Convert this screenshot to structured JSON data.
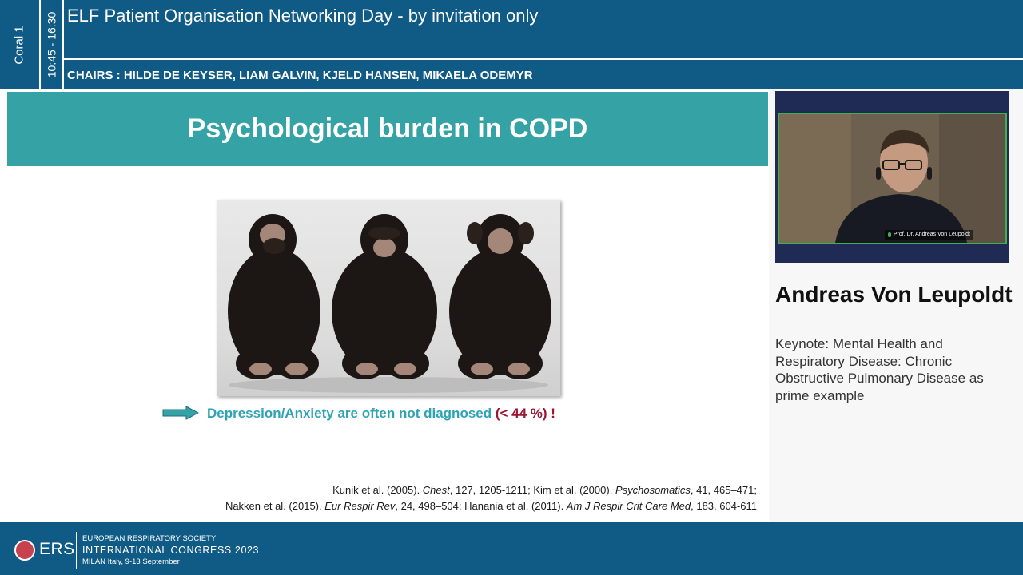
{
  "header": {
    "room": "Coral 1",
    "time": "10:45 - 16:30",
    "session_title": "ELF Patient Organisation Networking Day - by invitation only",
    "chairs": "CHAIRS : HILDE DE KEYSER, LIAM GALVIN, KJELD HANSEN, MIKAELA ODEMYR"
  },
  "slide": {
    "title": "Psychological burden in COPD",
    "message_main": "Depression/Anxiety are often not diagnosed ",
    "message_stat": "(< 44 %)",
    "message_end": " !",
    "ref1_a": "Kunik et al. (2005). ",
    "ref1_b": "Chest",
    "ref1_c": ", 127, 1205-1211; Kim et al. (2000). ",
    "ref1_d": "Psychosomatics",
    "ref1_e": ", 41, 465–471;",
    "ref2_a": "Nakken et al. (2015). ",
    "ref2_b": "Eur Respir Rev",
    "ref2_c": ", 24, 498–504; Hanania et al. (2011). ",
    "ref2_d": "Am J Respir Crit Care Med",
    "ref2_e": ", 183, 604-611"
  },
  "speaker": {
    "video_label": "Prof. Dr. Andreas Von Leupoldt",
    "name": "Andreas Von Leupoldt",
    "talk_title": "Keynote: Mental Health and Respiratory Disease: Chronic Obstructive Pulmonary Disease as prime example"
  },
  "footer": {
    "logo_text": "ERS",
    "society": "EUROPEAN RESPIRATORY SOCIETY",
    "congress": "INTERNATIONAL CONGRESS 2023",
    "location": "MILAN Italy, 9-13 September"
  },
  "colors": {
    "header_blue": "#0f5b86",
    "slide_teal": "#35a2a6",
    "message_teal": "#2fa3b6",
    "stat_red": "#9c1431",
    "active_speaker_green": "#3fb04e"
  }
}
